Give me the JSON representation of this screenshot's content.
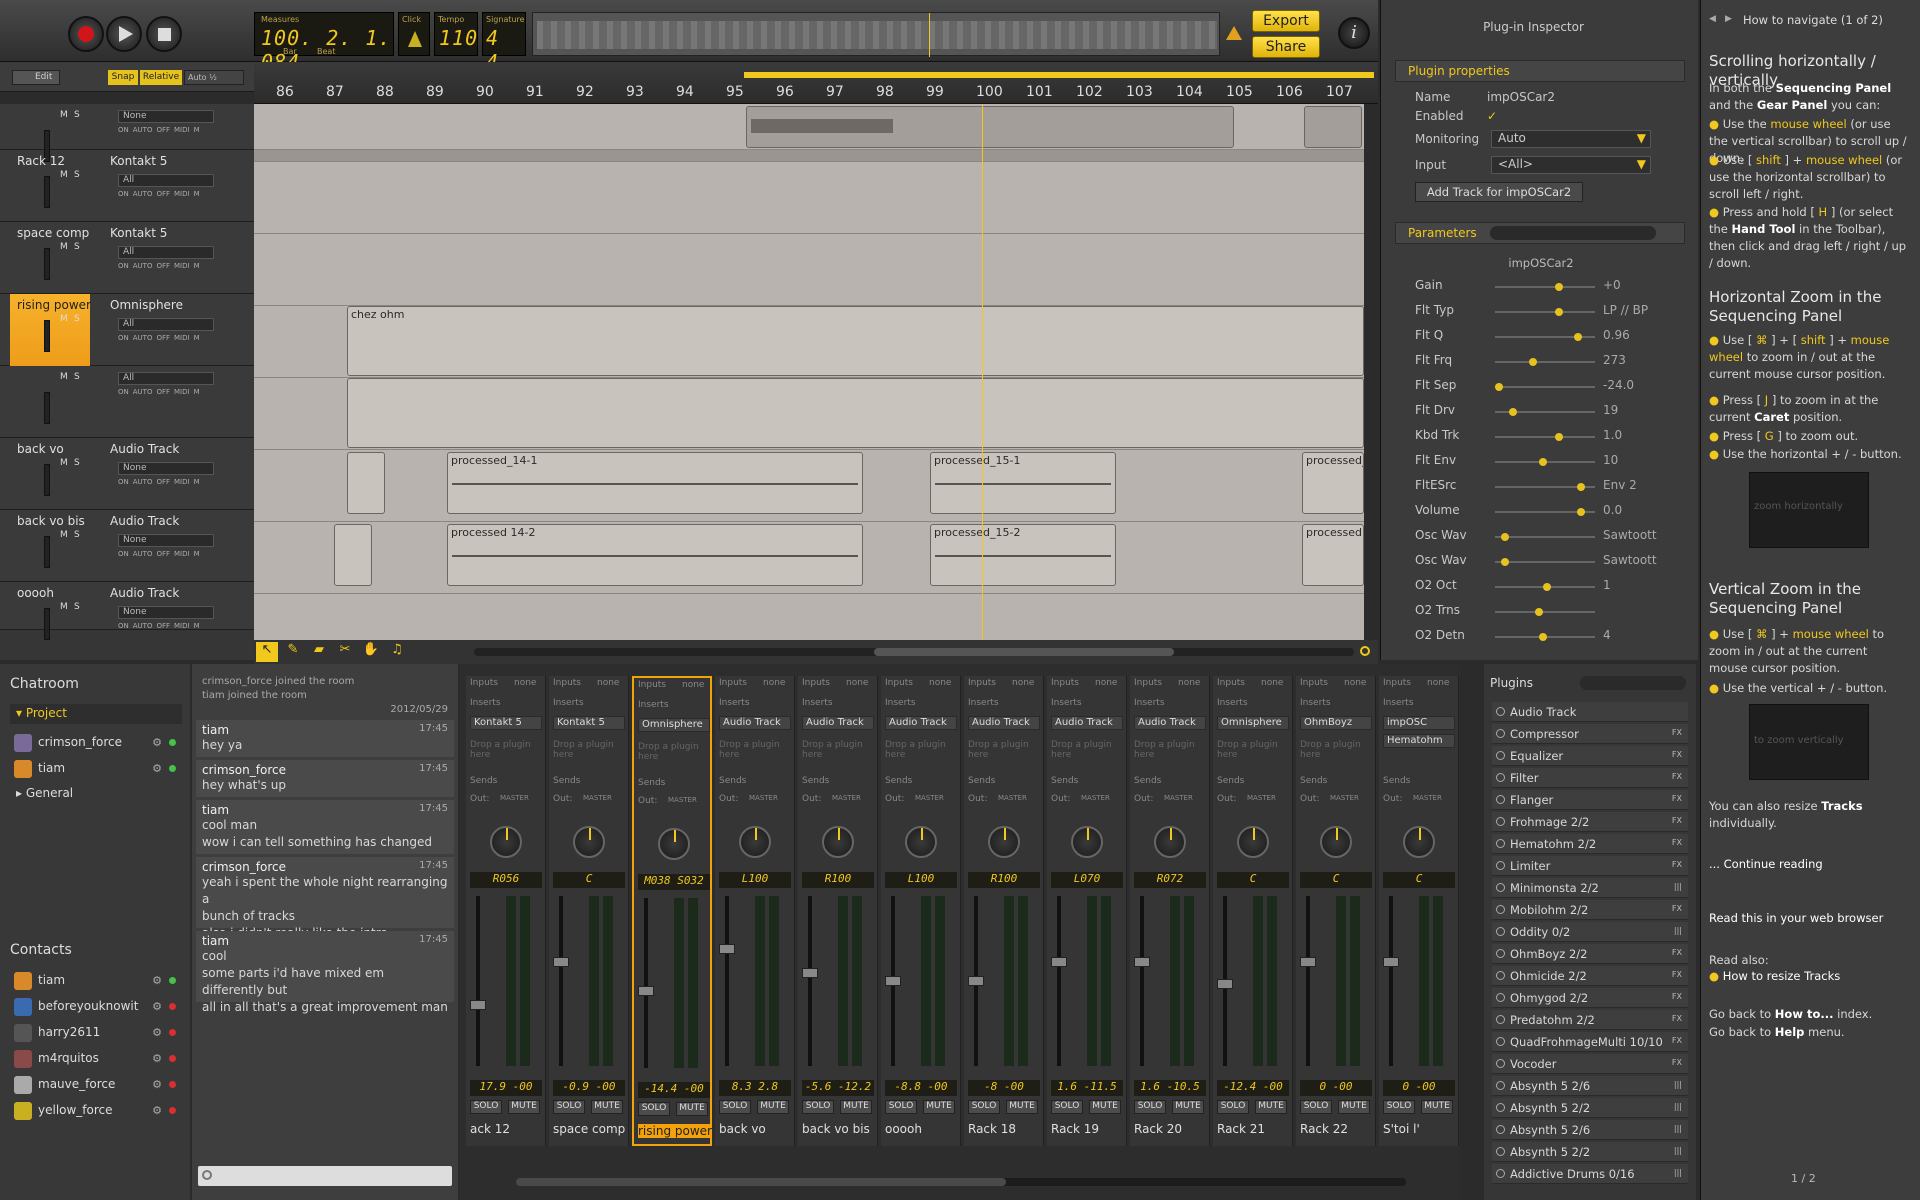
{
  "transport": {
    "record_icon": "record-icon",
    "measures_caption": "Measures",
    "position": "100. 2. 1. 084",
    "bar_caption": "Bar",
    "beat_caption": "Beat",
    "click_caption": "Click",
    "tempo_caption": "Tempo",
    "tempo": "110",
    "signature_caption": "Signature",
    "signature": "4 4",
    "export_label": "Export",
    "share_label": "Share"
  },
  "toolbar": {
    "edit_label": "Edit",
    "snap_label": "Snap",
    "relative_label": "Relative",
    "auto_label": "Auto ½"
  },
  "ruler": [
    "86",
    "87",
    "88",
    "89",
    "90",
    "91",
    "92",
    "93",
    "94",
    "95",
    "96",
    "97",
    "98",
    "99",
    "100",
    "101",
    "102",
    "103",
    "104",
    "105",
    "106",
    "107"
  ],
  "tracks": [
    {
      "name": "",
      "instrument": "",
      "input": "None"
    },
    {
      "name": "Rack 12",
      "instrument": "Kontakt 5",
      "input": "All"
    },
    {
      "name": "space comp",
      "instrument": "Kontakt 5",
      "input": "All"
    },
    {
      "name": "rising power",
      "instrument": "Omnisphere",
      "input": "All"
    },
    {
      "name": "",
      "instrument": "",
      "input": "All"
    },
    {
      "name": "back vo",
      "instrument": "Audio Track",
      "input": "None"
    },
    {
      "name": "back vo bis",
      "instrument": "Audio Track",
      "input": "None"
    },
    {
      "name": "ooooh",
      "instrument": "Audio Track",
      "input": "None"
    }
  ],
  "track_ribbon": {
    "on": "ON",
    "auto": "AUTO",
    "off": "OFF",
    "midi": "MIDI",
    "m": "M",
    "s": "S"
  },
  "clips": {
    "chez_ohm": "chez ohm",
    "p14_1": "processed_14-1",
    "p15_1": "processed_15-1",
    "p_a": "processed_",
    "p14_2": "processed 14-2",
    "p15_2": "processed_15-2",
    "p_b": "processed"
  },
  "inspector": {
    "title": "Plug-in Inspector",
    "props_header": "Plugin properties",
    "name_label": "Name",
    "name_value": "impOSCar2",
    "enabled_label": "Enabled",
    "enabled_value": "✓",
    "monitoring_label": "Monitoring",
    "monitoring_value": "Auto",
    "input_label": "Input",
    "input_value": "<All>",
    "add_track_button": "Add Track for impOSCar2",
    "params_header": "Parameters",
    "plugin_name": "impOSCar2",
    "params": [
      {
        "label": "Gain",
        "value": "+0",
        "level": 0.62
      },
      {
        "label": "Flt Typ",
        "value": "LP // BP",
        "level": 0.62
      },
      {
        "label": "Flt Q",
        "value": "0.96",
        "level": 0.82
      },
      {
        "label": "Flt Frq",
        "value": "273",
        "level": 0.35
      },
      {
        "label": "Flt Sep",
        "value": "-24.0",
        "level": 0.0
      },
      {
        "label": "Flt Drv",
        "value": "19",
        "level": 0.15
      },
      {
        "label": "Kbd Trk",
        "value": "1.0",
        "level": 0.62
      },
      {
        "label": "Flt Env",
        "value": "10",
        "level": 0.46
      },
      {
        "label": "FltESrc",
        "value": "Env 2",
        "level": 0.85
      },
      {
        "label": "Volume",
        "value": "0.0",
        "level": 0.85
      },
      {
        "label": "Osc Wav",
        "value": "Sawtoott",
        "level": 0.06
      },
      {
        "label": "Osc Wav",
        "value": "Sawtoott",
        "level": 0.06
      },
      {
        "label": "O2 Oct",
        "value": "1",
        "level": 0.5
      },
      {
        "label": "O2 Trns",
        "value": "",
        "level": 0.42
      },
      {
        "label": "O2 Detn",
        "value": "4",
        "level": 0.46
      }
    ]
  },
  "help": {
    "nav_title": "How to navigate (1 of 2)",
    "h1": "Scrolling horizontally / vertically",
    "p1a": "In both the ",
    "p1b": "Sequencing Panel",
    "p1c": " and the ",
    "p1d": "Gear Panel",
    "p1e": " you can:",
    "b1a": "Use the ",
    "b1b": "mouse wheel",
    "b1c": " (or use the vertical scrollbar) to scroll up / down.",
    "b2a": "Use [ ",
    "b2b": "shift",
    "b2c": " ] + ",
    "b2d": "mouse wheel",
    "b2e": " (or use the horizontal scrollbar) to scroll left / right.",
    "b3a": "Press and hold [ ",
    "b3b": "H",
    "b3c": " ] (or select the ",
    "b3d": "Hand Tool",
    "b3e": " in the Toolbar), then click and drag left / right / up / down.",
    "h2": "Horizontal Zoom in the Sequencing Panel",
    "z1a": "Use [ ",
    "z1b": "⌘",
    "z1c": " ] + [ ",
    "z1d": "shift",
    "z1e": " ] + ",
    "z1f": "mouse wheel",
    "z1g": " to zoom in / out at the current mouse cursor position.",
    "z2a": "Press [ ",
    "z2b": "J",
    "z2c": " ] to zoom in at the current ",
    "z2d": "Caret",
    "z2e": " position.",
    "z3a": "Press [ ",
    "z3b": "G",
    "z3c": " ] to zoom out.",
    "z4": "Use the horizontal + / - button.",
    "img1_caption": "zoom horizontally",
    "h3": "Vertical Zoom in the Sequencing Panel",
    "v1a": "Use [ ",
    "v1b": "⌘",
    "v1c": " ] + ",
    "v1d": "mouse wheel",
    "v1e": " to zoom in / out at the current mouse cursor position.",
    "v2": "Use the vertical + / - button.",
    "img2_caption": "to zoom vertically",
    "resize_a": "You can also resize ",
    "resize_b": "Tracks",
    "resize_c": " individually.",
    "continue": "... Continue reading",
    "browser": "Read this in your web browser",
    "read_also": "Read also:",
    "link_resize": "How to resize Tracks",
    "back1a": "Go back to ",
    "back1b": "How to...",
    "back1c": " index.",
    "back2a": "Go back to ",
    "back2b": "Help",
    "back2c": " menu.",
    "page": "1 / 2"
  },
  "chat": {
    "title": "Chatroom",
    "project": "Project",
    "general": "General",
    "members": [
      {
        "name": "crimson_force",
        "color": "#7a6a9a"
      },
      {
        "name": "tiam",
        "color": "#d88a2a"
      }
    ],
    "sys1": "crimson_force joined the room",
    "sys2": "tiam joined the room",
    "date": "2012/05/29",
    "messages": [
      {
        "author": "tiam",
        "time": "17:45",
        "lines": [
          "hey ya"
        ]
      },
      {
        "author": "crimson_force",
        "time": "17:45",
        "lines": [
          "hey what's up"
        ]
      },
      {
        "author": "tiam",
        "time": "17:45",
        "lines": [
          "cool man",
          "wow i can tell something has changed"
        ]
      },
      {
        "author": "crimson_force",
        "time": "17:45",
        "lines": [
          "yeah i spent the whole night rearranging a",
          "bunch of tracks",
          "also i didn't really like the intro"
        ]
      },
      {
        "author": "tiam",
        "time": "17:45",
        "lines": [
          "cool",
          "some parts i'd have mixed em differently but",
          "all in all that's a great improvement man"
        ]
      }
    ],
    "contacts_title": "Contacts",
    "contacts": [
      {
        "name": "tiam",
        "online": true,
        "color": "#d88a2a"
      },
      {
        "name": "beforeyouknowit",
        "online": false,
        "color": "#3a6ab0"
      },
      {
        "name": "harry2611",
        "online": false,
        "color": "#555"
      },
      {
        "name": "m4rquitos",
        "online": false,
        "color": "#8a4a4a"
      },
      {
        "name": "mauve_force",
        "online": false,
        "color": "#aaa"
      },
      {
        "name": "yellow_force",
        "online": false,
        "color": "#c9b020"
      }
    ]
  },
  "mixer": {
    "captions": {
      "inputs": "Inputs",
      "none": "none",
      "inserts": "Inserts",
      "drop": "Drop a plugin here",
      "sends": "Sends",
      "out": "Out:",
      "master": "MASTER",
      "solo": "SOLO",
      "mute": "MUTE"
    },
    "strips": [
      {
        "name": "ack 12",
        "plugin": "Kontakt 5",
        "pan": "R056",
        "vol": "17.9  -00",
        "fader": 0.35
      },
      {
        "name": "space comp",
        "plugin": "Kontakt 5",
        "pan": "C",
        "vol": "-0.9  -00",
        "fader": 0.62
      },
      {
        "name": "rising power",
        "plugin": "Omnisphere",
        "pan": "M038 S032",
        "vol": "-14.4  -00",
        "fader": 0.45
      },
      {
        "name": "back vo",
        "plugin": "Audio Track",
        "pan": "L100",
        "vol": "8.3  2.8",
        "fader": 0.7
      },
      {
        "name": "back vo bis",
        "plugin": "Audio Track",
        "pan": "R100",
        "vol": "-5.6  -12.2",
        "fader": 0.55
      },
      {
        "name": "ooooh",
        "plugin": "Audio Track",
        "pan": "L100",
        "vol": "-8.8  -00",
        "fader": 0.5
      },
      {
        "name": "Rack 18",
        "plugin": "Audio Track",
        "pan": "R100",
        "vol": "-8  -00",
        "fader": 0.5
      },
      {
        "name": "Rack 19",
        "plugin": "Audio Track",
        "pan": "L070",
        "vol": "1.6  -11.5",
        "fader": 0.62
      },
      {
        "name": "Rack 20",
        "plugin": "Audio Track",
        "pan": "R072",
        "vol": "1.6  -10.5",
        "fader": 0.62
      },
      {
        "name": "Rack 21",
        "plugin": "Omnisphere",
        "pan": "C",
        "vol": "-12.4  -00",
        "fader": 0.48
      },
      {
        "name": "Rack 22",
        "plugin": "OhmBoyz",
        "pan": "C",
        "vol": "0  -00",
        "fader": 0.62
      },
      {
        "name": "S'toi l'",
        "plugin": "impOSC",
        "plugin2": "Hematohm",
        "pan": "C",
        "vol": "0  -00",
        "fader": 0.62
      }
    ]
  },
  "plugins": {
    "title": "Plugins",
    "items": [
      {
        "name": "Audio Track",
        "fx": ""
      },
      {
        "name": "Compressor",
        "fx": "FX"
      },
      {
        "name": "Equalizer",
        "fx": "FX"
      },
      {
        "name": "Filter",
        "fx": "FX"
      },
      {
        "name": "Flanger",
        "fx": "FX"
      },
      {
        "name": "Frohmage 2/2",
        "fx": "FX"
      },
      {
        "name": "Hematohm 2/2",
        "fx": "FX"
      },
      {
        "name": "Limiter",
        "fx": "FX"
      },
      {
        "name": "Minimonsta 2/2",
        "fx": "|||"
      },
      {
        "name": "Mobilohm 2/2",
        "fx": "FX"
      },
      {
        "name": "Oddity 0/2",
        "fx": "|||"
      },
      {
        "name": "OhmBoyz 2/2",
        "fx": "FX"
      },
      {
        "name": "Ohmicide 2/2",
        "fx": "FX"
      },
      {
        "name": "Ohmygod 2/2",
        "fx": "FX"
      },
      {
        "name": "Predatohm 2/2",
        "fx": "FX"
      },
      {
        "name": "QuadFrohmageMulti 10/10",
        "fx": "FX"
      },
      {
        "name": "Vocoder",
        "fx": "FX"
      },
      {
        "name": "Absynth 5 2/6",
        "fx": "|||"
      },
      {
        "name": "Absynth 5 2/2",
        "fx": "|||"
      },
      {
        "name": "Absynth 5 2/6",
        "fx": "|||"
      },
      {
        "name": "Absynth 5 2/2",
        "fx": "|||"
      },
      {
        "name": "Addictive Drums 0/16",
        "fx": "|||"
      }
    ]
  }
}
